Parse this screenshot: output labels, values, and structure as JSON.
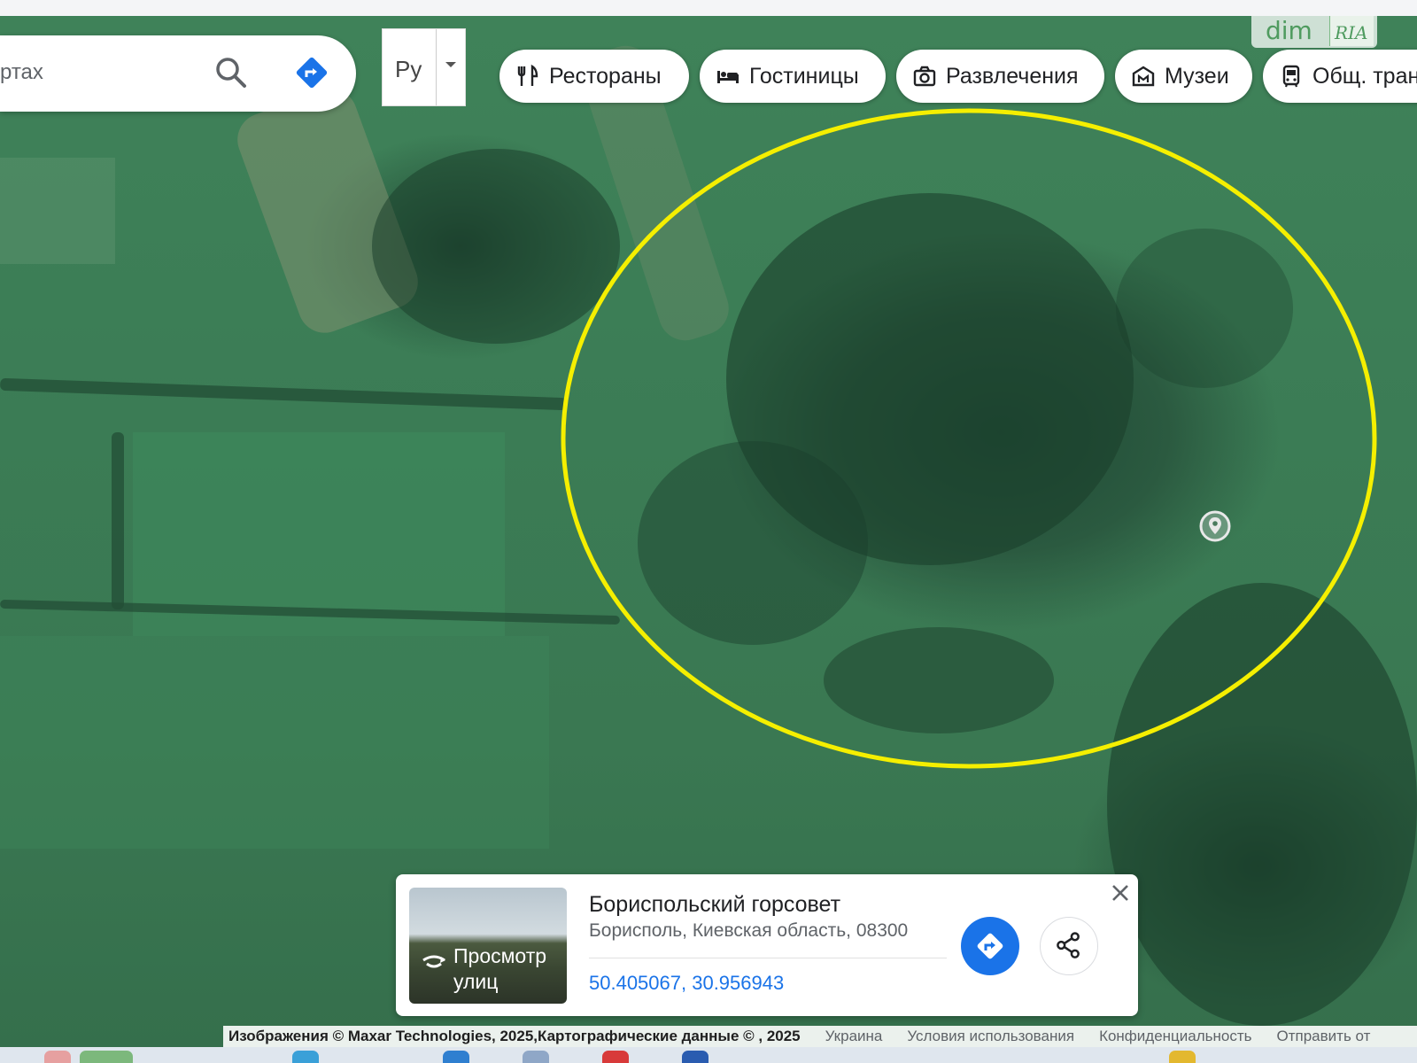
{
  "search": {
    "partial_text": "ртах"
  },
  "language": {
    "label": "Ру"
  },
  "categories": [
    {
      "label": "Рестораны",
      "icon": "restaurant-icon"
    },
    {
      "label": "Гостиницы",
      "icon": "hotel-icon"
    },
    {
      "label": "Развлечения",
      "icon": "camera-icon"
    },
    {
      "label": "Музеи",
      "icon": "museum-icon"
    },
    {
      "label": "Общ. тран",
      "icon": "transit-icon"
    }
  ],
  "watermark": {
    "brand": "dim",
    "brand2": "RIA"
  },
  "place": {
    "title": "Бориспольский горсовет",
    "address": "Борисполь, Киевская область, 08300",
    "coordinates": "50.405067, 30.956943",
    "street_view_line1": "Просмотр",
    "street_view_line2": "улиц"
  },
  "attribution": {
    "imagery": "Изображения © Maxar Technologies, 2025,Картографические данные © , 2025",
    "country": "Украина",
    "terms": "Условия использования",
    "privacy": "Конфиденциальность",
    "feedback": "Отправить от"
  },
  "colors": {
    "highlight": "#f5ef00",
    "accent": "#1a73e8",
    "map_green": "#3b7c55"
  }
}
